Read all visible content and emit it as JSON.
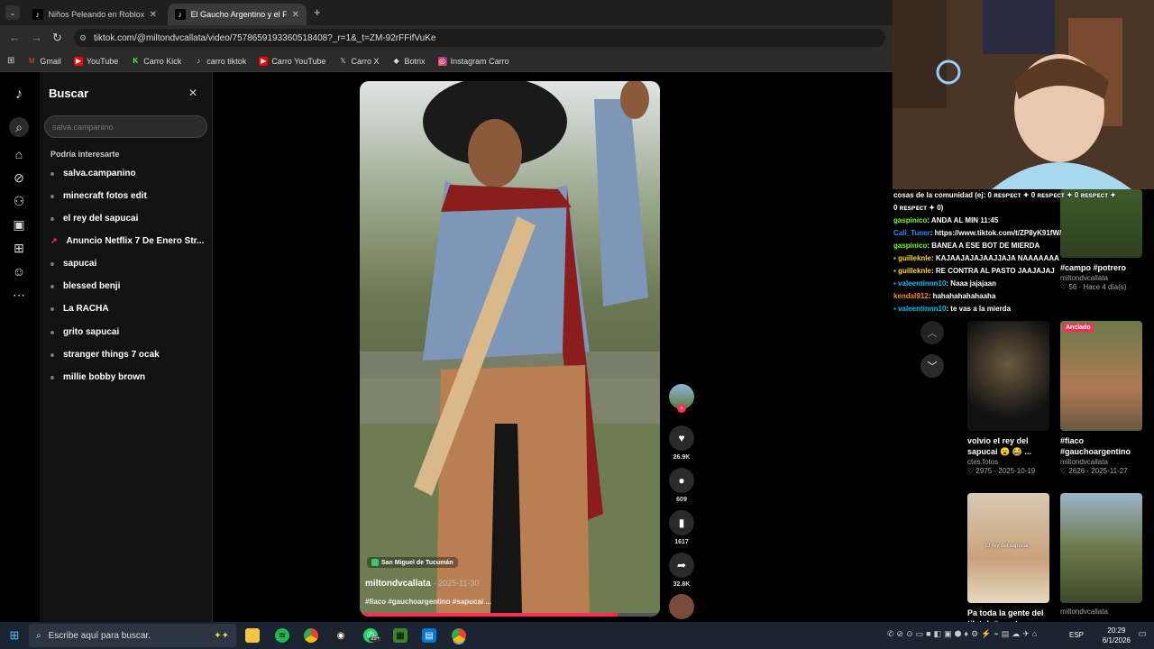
{
  "browser": {
    "tabs": [
      {
        "label": "Niños Peleando en Roblox: Mo",
        "active": false
      },
      {
        "label": "El Gaucho Argentino y el Folkló",
        "active": true
      }
    ],
    "new_tab": "+",
    "url": "tiktok.com/@miltondvcallata/video/7578659193360518408?_r=1&_t=ZM-92rFFifVuKe",
    "bookmarks": [
      "Gmail",
      "YouTube",
      "Carro Kick",
      "carro tiktok",
      "Carro YouTube",
      "Carro X",
      "Botrix",
      "Instagram Carro"
    ]
  },
  "search_panel": {
    "title": "Buscar",
    "close": "✕",
    "input_placeholder": "salva.campanino",
    "heading": "Podría interesarte",
    "suggestions": [
      {
        "label": "salva.campanino",
        "trending": false
      },
      {
        "label": "minecraft fotos edit",
        "trending": false
      },
      {
        "label": "el rey del sapucai",
        "trending": false
      },
      {
        "label": "Anuncio Netflix 7 De Enero Str...",
        "trending": true
      },
      {
        "label": "sapucai",
        "trending": false
      },
      {
        "label": "blessed benji",
        "trending": false
      },
      {
        "label": "La RACHA",
        "trending": false
      },
      {
        "label": "grito sapucai",
        "trending": false
      },
      {
        "label": "stranger things 7 ocak",
        "trending": false
      },
      {
        "label": "millie bobby brown",
        "trending": false
      }
    ]
  },
  "video": {
    "location": "San Miguel de Tucumán",
    "author": "miltondvcallata",
    "date": "· 2025-11-30",
    "caption": "#fiaco #gauchoargentino #sapucai ...",
    "progress": 0.86
  },
  "actions": {
    "likes": "26.9K",
    "comments": "609",
    "saves": "1617",
    "shares": "32.8K"
  },
  "grid": [
    {
      "title": "#campo #potrero",
      "user": "miltondvcallata",
      "meta": "♡ 56 · Hace 4 día(s)",
      "pinned": false
    },
    {
      "title": "",
      "user": "",
      "meta": "",
      "pinned": false
    },
    {
      "title": "volvio el rey del sapucai 😮 😂 ...",
      "user": "ctes.fotos",
      "meta": "♡ 2975 · 2025-10-19",
      "pinned": false
    },
    {
      "title": "#fiaco #gauchoargentino",
      "user": "miltondvcallata",
      "meta": "♡ 2626 · 2025-11-27",
      "pinned": true,
      "pinned_label": "Anclado"
    },
    {
      "title": "Pa toda la gente del tik tok #parat...",
      "user": "",
      "meta": "",
      "pinned": false,
      "overlay": "El rey del sapucai"
    },
    {
      "title": "",
      "user": "miltondvcallata",
      "meta": "",
      "pinned": false
    }
  ],
  "chat": [
    {
      "user": "",
      "text": "cosas de la comunidad (ej: 0 ʀᴇsᴘᴇᴄᴛ ✦ 0 ʀᴇsᴘᴇᴄᴛ ✦ 0 ʀᴇsᴘᴇᴄᴛ ✦",
      "color": "#ffffff"
    },
    {
      "user": "",
      "text": "0 ʀᴇsᴘᴇᴄᴛ ✦ 0)",
      "color": "#ffffff"
    },
    {
      "user": "gaspinico",
      "text": ": ANDA AL MIN 11:45",
      "color": "#7cfc00"
    },
    {
      "user": "Cali_Tuner",
      "text": ": https://www.tiktok.com/t/ZP8yK91fW/",
      "color": "#1e90ff"
    },
    {
      "user": "gaspinico",
      "text": ": BANEA A ESE BOT DE MIERDA",
      "color": "#7cfc00"
    },
    {
      "user": "guilleknle",
      "text": ": KAJAAJAJAJAAJJAJA NAAAAAAA",
      "color": "#ffd700"
    },
    {
      "user": "guilleknle",
      "text": ": RE CONTRA AL PASTO JAAJAJAJ",
      "color": "#ffd700"
    },
    {
      "user": "valeentinnn10",
      "text": ": Naaa jajajaan",
      "color": "#00bfff"
    },
    {
      "user": "kendal912",
      "text": ": hahahahahahaaha",
      "color": "#ff8c00"
    },
    {
      "user": "valeentinnn10",
      "text": ": te vas a la mierda",
      "color": "#00bfff"
    }
  ],
  "taskbar": {
    "search_placeholder": "Escribe aquí para buscar.",
    "lang": "ESP",
    "time": "20:29",
    "date": "6/1/2026",
    "badge": "99+"
  },
  "colors": {
    "accent": "#fe2c55",
    "panel": "#121212"
  }
}
